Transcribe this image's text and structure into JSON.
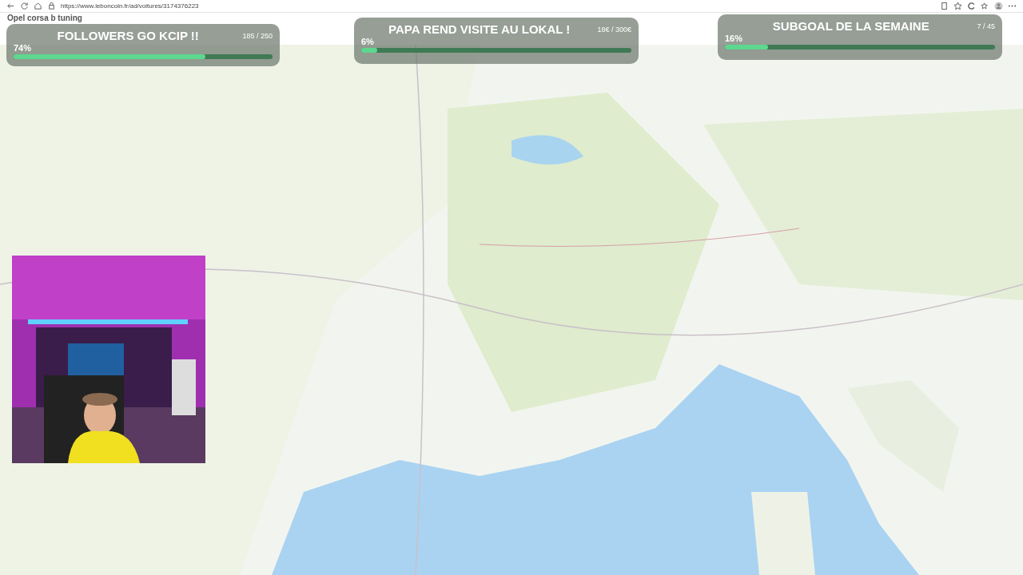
{
  "browser": {
    "url": "https://www.leboncoin.fr/ad/voitures/3174376223"
  },
  "page": {
    "title": "Opel corsa b tuning"
  },
  "goals": [
    {
      "title": "FOLLOWERS GO KCIP !!",
      "count": "185 / 250",
      "percent": "74%",
      "level": 0.74
    },
    {
      "title": "PAPA REND VISITE AU LOKAL !",
      "count": "18€ / 300€",
      "percent": "6%",
      "level": 0.06
    },
    {
      "title": "SUBGOAL DE LA SEMAINE",
      "count": "7 / 45",
      "percent": "16%",
      "level": 0.16
    }
  ]
}
